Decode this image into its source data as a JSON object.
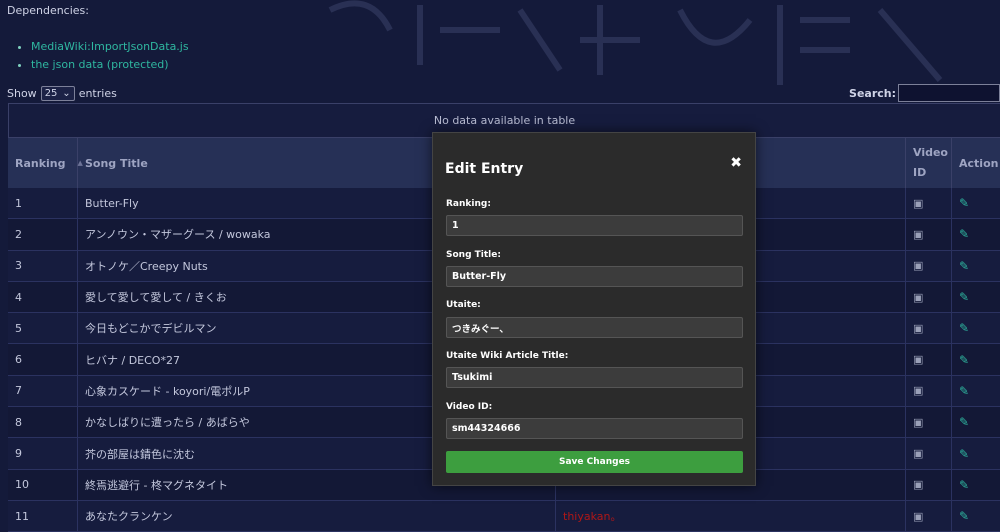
{
  "dependencies": {
    "title": "Dependencies:",
    "links": [
      "MediaWiki:ImportJsonData.js",
      "the json data (protected)"
    ]
  },
  "controls": {
    "show_label": "Show",
    "entries_value": "25",
    "entries_label": "entries",
    "search_label": "Search:"
  },
  "table": {
    "no_data": "No data available in table",
    "headers": {
      "ranking": "Ranking",
      "song_title": "Song Title",
      "utaite": "",
      "video_id_line1": "Video",
      "video_id_line2": "ID",
      "action": "Action"
    },
    "rows": [
      {
        "rank": "1",
        "title": "Butter-Fly",
        "utaite": ""
      },
      {
        "rank": "2",
        "title": "アンノウン・マザーグース / wowaka",
        "utaite": ""
      },
      {
        "rank": "3",
        "title": "オトノケ／Creepy Nuts",
        "utaite": ""
      },
      {
        "rank": "4",
        "title": "愛して愛して愛して / きくお",
        "utaite": ""
      },
      {
        "rank": "5",
        "title": "今日もどこかでデビルマン",
        "utaite": ""
      },
      {
        "rank": "6",
        "title": "ヒバナ / DECO*27",
        "utaite": ""
      },
      {
        "rank": "7",
        "title": "心象カスケード - koyori/電ポルP",
        "utaite": ""
      },
      {
        "rank": "8",
        "title": "かなしばりに遭ったら / あばらや",
        "utaite": ""
      },
      {
        "rank": "9",
        "title": "芥の部屋は錆色に沈む",
        "utaite": ""
      },
      {
        "rank": "10",
        "title": "終焉逃避行 - 柊マグネタイト",
        "utaite": ""
      },
      {
        "rank": "11",
        "title": "あなたクランケン",
        "utaite": "thiyakan。"
      }
    ]
  },
  "modal": {
    "title": "Edit Entry",
    "close_icon": "close-icon",
    "fields": [
      {
        "label": "Ranking:",
        "value": "1"
      },
      {
        "label": "Song Title:",
        "value": "Butter-Fly"
      },
      {
        "label": "Utaite:",
        "value": "つきみぐー、"
      },
      {
        "label": "Utaite Wiki Article Title:",
        "value": "Tsukimi"
      },
      {
        "label": "Video ID:",
        "value": "sm44324666"
      }
    ],
    "save_label": "Save Changes"
  },
  "colors": {
    "background": "#141a3a",
    "link": "#2fb7a0",
    "save_button": "#3d9e3f",
    "modal_bg": "#2b2b2b"
  }
}
